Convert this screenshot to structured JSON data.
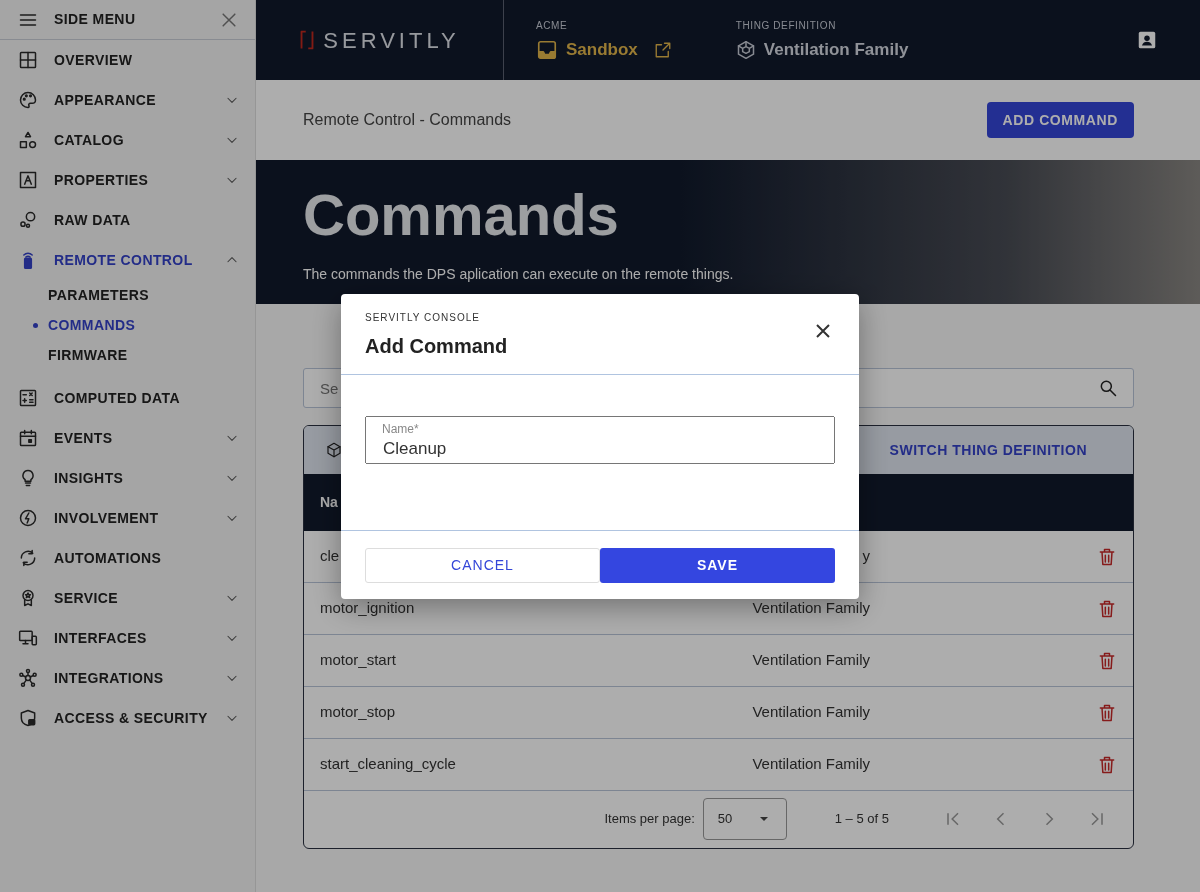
{
  "sidebar": {
    "title": "SIDE MENU",
    "items": [
      {
        "label": "OVERVIEW",
        "expandable": false,
        "selected": false
      },
      {
        "label": "APPEARANCE",
        "expandable": true,
        "expanded": false,
        "selected": false
      },
      {
        "label": "CATALOG",
        "expandable": true,
        "expanded": false,
        "selected": false
      },
      {
        "label": "PROPERTIES",
        "expandable": true,
        "expanded": false,
        "selected": false
      },
      {
        "label": "RAW DATA",
        "expandable": false,
        "selected": false
      },
      {
        "label": "REMOTE CONTROL",
        "expandable": true,
        "expanded": true,
        "selected": true,
        "children": [
          {
            "label": "PARAMETERS",
            "selected": false
          },
          {
            "label": "COMMANDS",
            "selected": true
          },
          {
            "label": "FIRMWARE",
            "selected": false
          }
        ]
      },
      {
        "label": "COMPUTED DATA",
        "expandable": false,
        "selected": false
      },
      {
        "label": "EVENTS",
        "expandable": true,
        "expanded": false,
        "selected": false
      },
      {
        "label": "INSIGHTS",
        "expandable": true,
        "expanded": false,
        "selected": false
      },
      {
        "label": "INVOLVEMENT",
        "expandable": true,
        "expanded": false,
        "selected": false
      },
      {
        "label": "AUTOMATIONS",
        "expandable": false,
        "selected": false
      },
      {
        "label": "SERVICE",
        "expandable": true,
        "expanded": false,
        "selected": false
      },
      {
        "label": "INTERFACES",
        "expandable": true,
        "expanded": false,
        "selected": false
      },
      {
        "label": "INTEGRATIONS",
        "expandable": true,
        "expanded": false,
        "selected": false
      },
      {
        "label": "ACCESS & SECURITY",
        "expandable": true,
        "expanded": false,
        "selected": false
      }
    ]
  },
  "header": {
    "logo": "SERVITLY",
    "tenant_label": "ACME",
    "tenant": "Sandbox",
    "thing_definition_label": "THING DEFINITION",
    "thing_definition": "Ventilation Family"
  },
  "toolbar": {
    "breadcrumb": "Remote Control - Commands",
    "add_button": "ADD COMMAND"
  },
  "hero": {
    "title": "Commands",
    "subtitle": "The commands the DPS aplication can execute on the remote things."
  },
  "search": {
    "placeholder": "Se"
  },
  "table": {
    "switch_button": "SWITCH THING DEFINITION",
    "columns": [
      "Na"
    ],
    "rows": [
      {
        "name": "cle",
        "thing_definition": "y"
      },
      {
        "name": "motor_ignition",
        "thing_definition": "Ventilation Family"
      },
      {
        "name": "motor_start",
        "thing_definition": "Ventilation Family"
      },
      {
        "name": "motor_stop",
        "thing_definition": "Ventilation Family"
      },
      {
        "name": "start_cleaning_cycle",
        "thing_definition": "Ventilation Family"
      }
    ],
    "paginator": {
      "label": "Items per page:",
      "page_size": "50",
      "range": "1 – 5 of 5",
      "buttons": [
        {
          "disabled": true
        },
        {
          "disabled": true
        },
        {
          "disabled": true
        },
        {
          "disabled": true
        }
      ]
    }
  },
  "dialog": {
    "overline": "SERVITLY CONSOLE",
    "title": "Add Command",
    "field": {
      "label": "Name*",
      "value": "Cleanup"
    },
    "buttons": [
      {
        "label": "CANCEL",
        "kind": "secondary"
      },
      {
        "label": "SAVE",
        "kind": "primary"
      }
    ]
  }
}
